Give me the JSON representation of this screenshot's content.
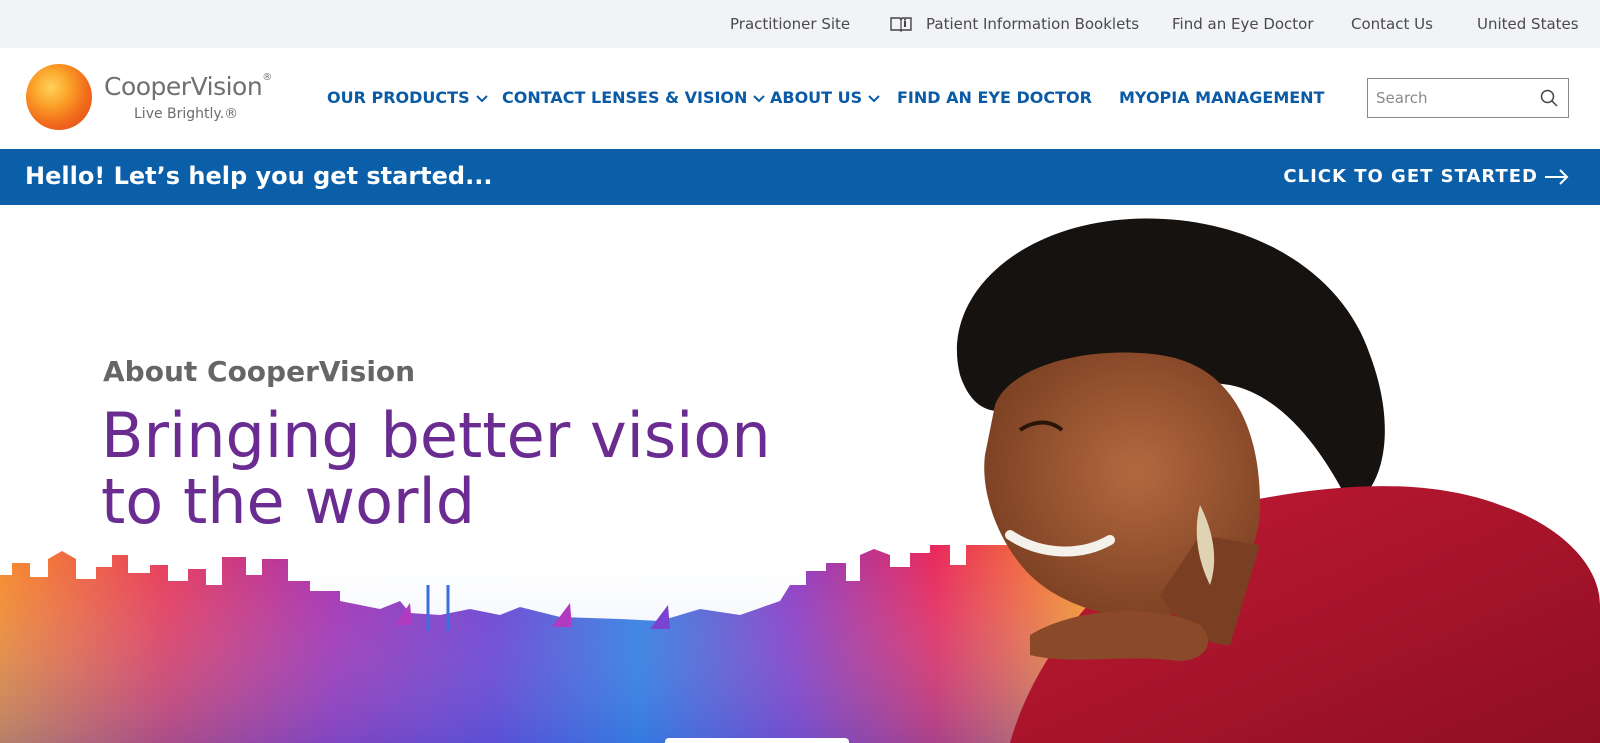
{
  "utility_nav": {
    "practitioner": "Practitioner Site",
    "booklets": "Patient Information Booklets",
    "find_doctor": "Find an Eye Doctor",
    "contact": "Contact Us",
    "region": "United States"
  },
  "logo": {
    "name": "CooperVision",
    "tagline": "Live Brightly.®"
  },
  "main_nav": {
    "products": "OUR PRODUCTS",
    "lenses_vision": "CONTACT LENSES & VISION",
    "about": "ABOUT US",
    "find_doctor": "FIND AN EYE DOCTOR",
    "myopia": "MYOPIA MANAGEMENT"
  },
  "search": {
    "placeholder": "Search"
  },
  "banner": {
    "text": "Hello! Let’s help you get started...",
    "cta": "CLICK TO GET STARTED"
  },
  "hero": {
    "eyebrow": "About CooperVision",
    "title": "Bringing better vision to the world"
  },
  "colors": {
    "brand_blue": "#0a5fa8",
    "nav_blue": "#0b5aa6",
    "hero_purple": "#6a2c91",
    "utility_bg": "#f1f3f6"
  },
  "icons": [
    "booklet-icon",
    "chevron-down-icon",
    "search-icon",
    "arrow-right-icon"
  ]
}
